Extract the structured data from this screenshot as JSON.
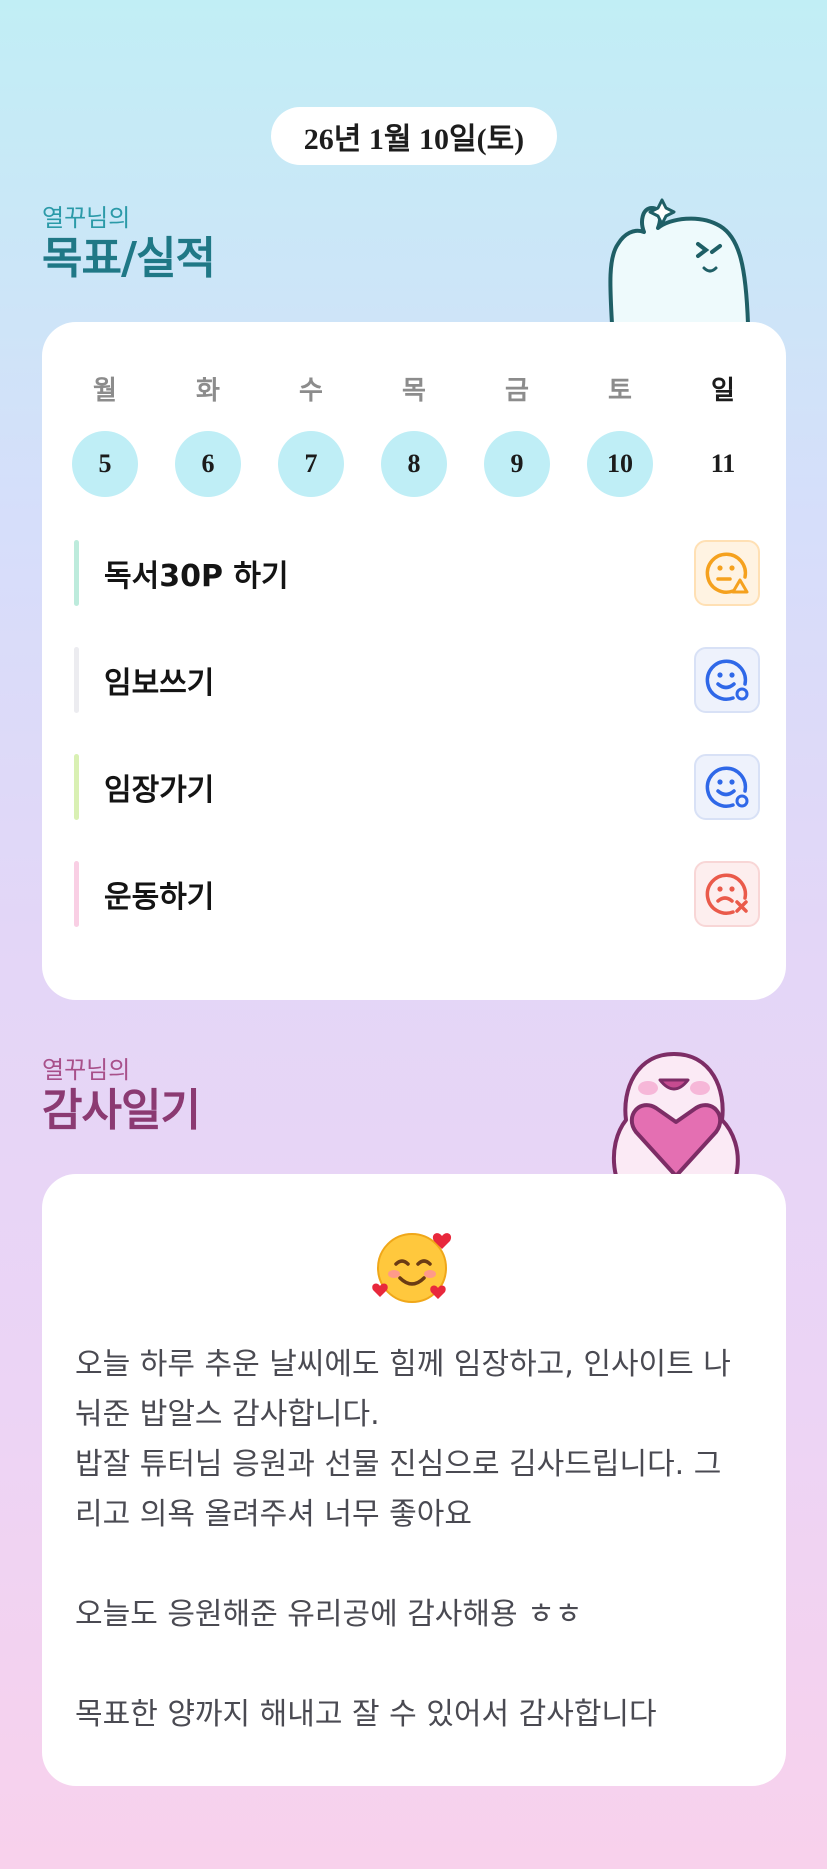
{
  "date": "26년 1월 10일(토)",
  "goals_section": {
    "subtitle": "열꾸님의",
    "title": "목표/실적"
  },
  "week": {
    "days": [
      "월",
      "화",
      "수",
      "목",
      "금",
      "토",
      "일"
    ],
    "dates": [
      "5",
      "6",
      "7",
      "8",
      "9",
      "10",
      "11"
    ]
  },
  "goals": [
    {
      "label": "독서30P  하기",
      "status": "warning",
      "status_icon": "face-warning-icon",
      "bar_color": "#bdebdc"
    },
    {
      "label": "임보쓰기",
      "status": "ok",
      "status_icon": "face-smile-o-icon",
      "bar_color": "#ececf0"
    },
    {
      "label": "임장가기",
      "status": "ok",
      "status_icon": "face-smile-o-icon",
      "bar_color": "#d9f0b3"
    },
    {
      "label": "운동하기",
      "status": "fail",
      "status_icon": "face-x-icon",
      "bar_color": "#f9cfe4"
    }
  ],
  "thanks_section": {
    "subtitle": "열꾸님의",
    "title": "감사일기"
  },
  "diary": {
    "emoji": "smiling-face-with-hearts",
    "lines": [
      "오늘 하루 추운 날씨에도 힘께 임장하고, 인사이트 나",
      "눠준 밥알스 감사합니다.",
      "밥잘 튜터님 응원과 선물 진심으로 김사드립니다. 그",
      "리고 의욕 올려주셔 너무 좋아요",
      "",
      "오늘도 응원해준 유리공에 감사해용 ㅎㅎ",
      "",
      "목표한 양까지 해내고 잘 수 있어서 감사합니다"
    ]
  },
  "colors": {
    "completed_date": "#bfeef6",
    "warning": "#f5a11e",
    "ok": "#2f68e8",
    "fail": "#ea5a4a"
  }
}
